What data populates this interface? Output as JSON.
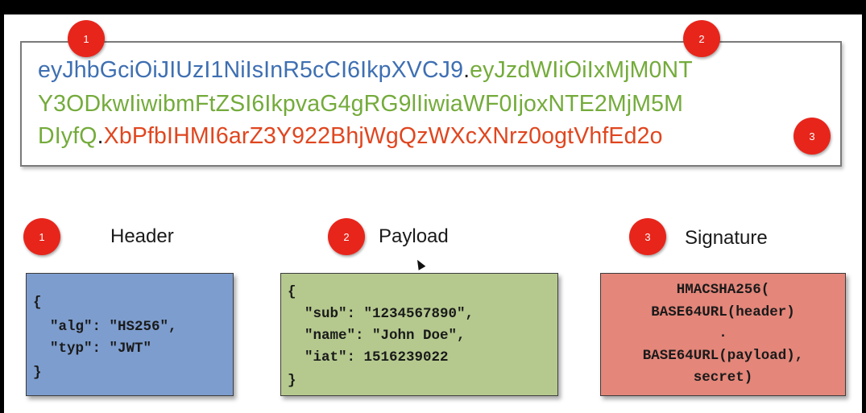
{
  "token": {
    "line1_header": "eyJhbGciOiJIUzI1NiIsInR5cCI6IkpXVCJ9",
    "line1_dot": ".",
    "line1_payload": "eyJzdWIiOiIxMjM0NT",
    "line2_payload": "Y3ODkwIiwibmFtZSI6IkpvaG4gRG9lIiwiaWF0IjoxNTE2MjM5M",
    "line3_payload": "DIyfQ",
    "line3_dot": ".",
    "line3_signature": "XbPfbIHMI6arZ3Y922BhjWgQzWXcXNrz0ogtVhfEd2o"
  },
  "badges": {
    "one": "1",
    "two": "2",
    "three": "3"
  },
  "sections": {
    "header": {
      "title": "Header",
      "lines": [
        "{",
        "  \"alg\": \"HS256\",",
        "  \"typ\": \"JWT\"",
        "}"
      ]
    },
    "payload": {
      "title": "Payload",
      "lines": [
        "{",
        "  \"sub\": \"1234567890\",",
        "  \"name\": \"John Doe\",",
        "  \"iat\": 1516239022",
        "}"
      ]
    },
    "signature": {
      "title": "Signature",
      "lines": [
        "HMACSHA256(",
        "BASE64URL(header)",
        ".",
        "BASE64URL(payload),",
        "secret)"
      ]
    }
  },
  "colors": {
    "header": "#3e6fb2",
    "payload": "#74ab3b",
    "signature": "#e0461f",
    "badge": "#e8251b",
    "header_box": "#7d9dce",
    "payload_box": "#b5c98e",
    "signature_box": "#e4867a"
  }
}
